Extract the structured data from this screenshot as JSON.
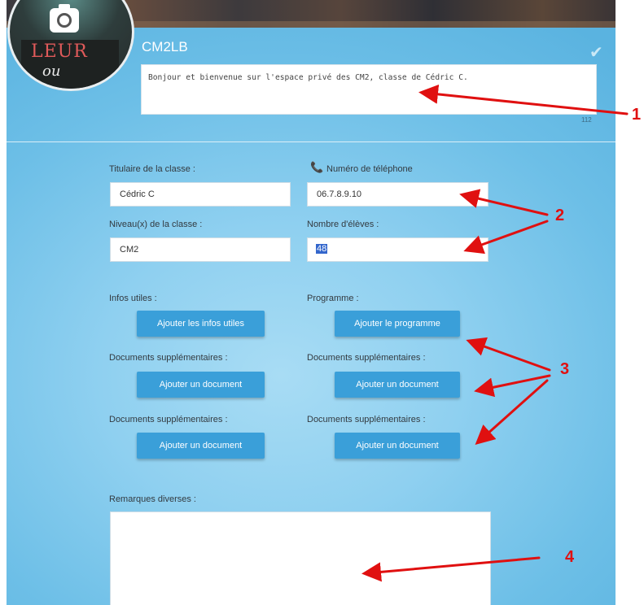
{
  "header": {
    "class_code": "CM2LB",
    "welcome_message": "Bonjour et bienvenue sur l'espace privé des CM2, classe de Cédric C.",
    "char_counter": "112",
    "check_glyph": "✔"
  },
  "avatar": {
    "line1": "LEUR",
    "line2": "ou"
  },
  "form": {
    "teacher_label": "Titulaire de la classe :",
    "teacher_value": "Cédric C",
    "phone_label": "Numéro de téléphone",
    "phone_value": "06.7.8.9.10",
    "level_label": "Niveau(x) de la classe :",
    "level_value": "CM2",
    "students_label": "Nombre d'élèves :",
    "students_value": "48"
  },
  "sections": {
    "infos_label": "Infos utiles :",
    "infos_button": "Ajouter les infos utiles",
    "program_label": "Programme :",
    "program_button": "Ajouter le programme",
    "docs": [
      {
        "label": "Documents supplémentaires :",
        "button": "Ajouter un document"
      },
      {
        "label": "Documents supplémentaires :",
        "button": "Ajouter un document"
      },
      {
        "label": "Documents supplémentaires :",
        "button": "Ajouter un document"
      },
      {
        "label": "Documents supplémentaires :",
        "button": "Ajouter un document"
      }
    ],
    "remarks_label": "Remarques diverses :"
  },
  "annotations": {
    "n1": "1",
    "n2": "2",
    "n3": "3",
    "n4": "4"
  },
  "colors": {
    "accent_button": "#3a9fd9",
    "annotation_red": "#e01010",
    "selection": "#3366cc"
  },
  "icons": [
    "camera-icon",
    "check-icon",
    "phone-icon"
  ]
}
